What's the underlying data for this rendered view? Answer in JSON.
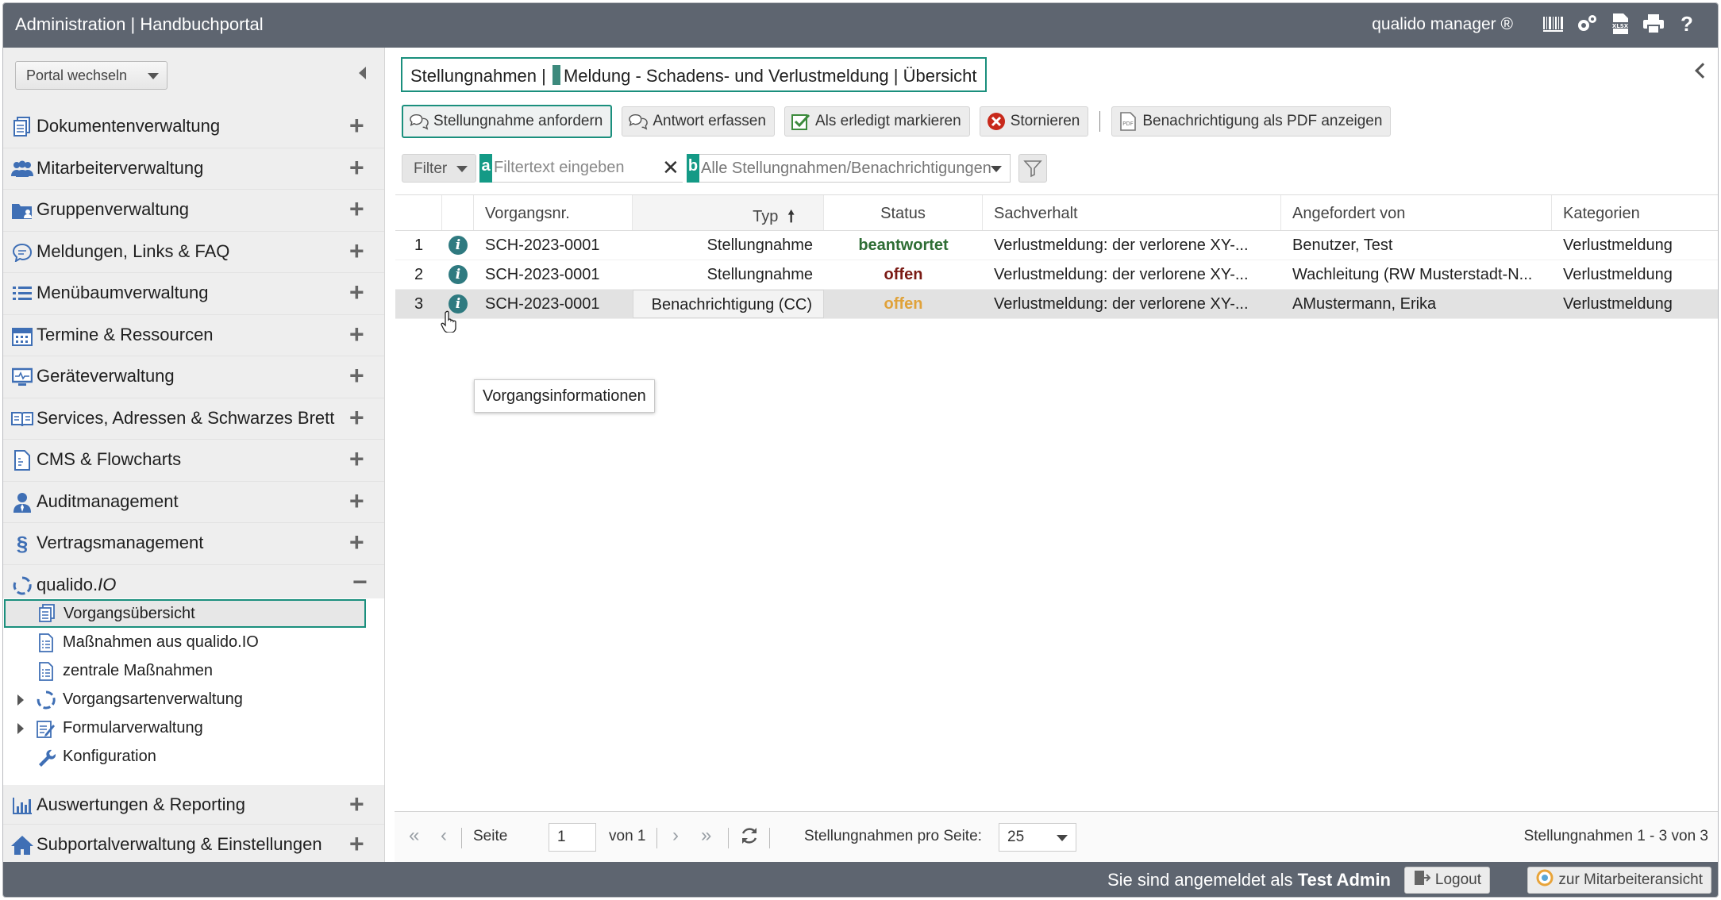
{
  "header": {
    "title": "Administration | Handbuchportal",
    "brand": "qualido manager ®",
    "icons": [
      "barcode-icon",
      "settings-icon",
      "xlsx-icon",
      "print-icon",
      "help-icon"
    ]
  },
  "sidebar": {
    "portal_select": "Portal wechseln",
    "items": [
      {
        "label": "Dokumentenverwaltung",
        "icon": "documents-icon"
      },
      {
        "label": "Mitarbeiterverwaltung",
        "icon": "users-icon"
      },
      {
        "label": "Gruppenverwaltung",
        "icon": "group-folder-icon"
      },
      {
        "label": "Meldungen, Links & FAQ",
        "icon": "chat-icon"
      },
      {
        "label": "Menübaumverwaltung",
        "icon": "list-icon"
      },
      {
        "label": "Termine & Ressourcen",
        "icon": "calendar-icon"
      },
      {
        "label": "Geräteverwaltung",
        "icon": "monitor-icon"
      },
      {
        "label": "Services, Adressen & Schwarzes Brett",
        "icon": "book-icon"
      },
      {
        "label": "CMS & Flowcharts",
        "icon": "cms-icon"
      },
      {
        "label": "Auditmanagement",
        "icon": "auditor-icon"
      },
      {
        "label": "Vertragsmanagement",
        "icon": "paragraph-icon"
      }
    ],
    "expanded": {
      "label": "qualido.",
      "label_italic": "IO",
      "icon": "qualido-icon"
    },
    "sub_items": [
      {
        "label": "Vorgangsübersicht",
        "icon": "documents-icon"
      },
      {
        "label": "Maßnahmen aus qualido.IO",
        "icon": "checklist-icon"
      },
      {
        "label": "zentrale Maßnahmen",
        "icon": "checklist-icon"
      },
      {
        "label": "Vorgangsartenverwaltung",
        "icon": "qualido-icon"
      },
      {
        "label": "Formularverwaltung",
        "icon": "form-edit-icon"
      },
      {
        "label": "Konfiguration",
        "icon": "wrench-icon"
      }
    ],
    "bottom_items": [
      {
        "label": "Auswertungen & Reporting",
        "icon": "bar-chart-icon"
      },
      {
        "label": "Subportalverwaltung & Einstellungen",
        "icon": "home-icon"
      }
    ]
  },
  "breadcrumb": {
    "part1": "Stellungnahmen |",
    "part2": "Meldung - Schadens- und Verlustmeldung | Übersicht"
  },
  "toolbar": {
    "request": "Stellungnahme anfordern",
    "answer": "Antwort erfassen",
    "done": "Als erledigt markieren",
    "cancel": "Stornieren",
    "pdf": "Benachrichtigung als PDF anzeigen"
  },
  "filter": {
    "label": "Filter",
    "badge_a": "a",
    "text_placeholder": "Filtertext eingeben",
    "badge_b": "b",
    "select_value": "Alle Stellungnahmen/Benachrichtigungen"
  },
  "table": {
    "columns": [
      "Vorgangsnr.",
      "Typ",
      "Status",
      "Sachverhalt",
      "Angefordert von",
      "Kategorien"
    ],
    "rows": [
      {
        "num": "1",
        "vorgang": "SCH-2023-0001",
        "typ": "Stellungnahme",
        "status": "beantwortet",
        "status_color": "#2e6d34",
        "sachverhalt": "Verlustmeldung: der verlorene XY-...",
        "angefordert": "Benutzer, Test",
        "kategorie": "Verlustmeldung"
      },
      {
        "num": "2",
        "vorgang": "SCH-2023-0001",
        "typ": "Stellungnahme",
        "status": "offen",
        "status_color": "#7a1a14",
        "sachverhalt": "Verlustmeldung: der verlorene XY-...",
        "angefordert": "Wachleitung (RW Musterstadt-N...",
        "kategorie": "Verlustmeldung"
      },
      {
        "num": "3",
        "vorgang": "SCH-2023-0001",
        "typ": "Benachrichtigung (CC)",
        "status": "offen",
        "status_color": "#e0a23a",
        "sachverhalt": "Verlustmeldung: der verlorene XY-...",
        "angefordert": "AMustermann, Erika",
        "kategorie": "Verlustmeldung"
      }
    ],
    "tooltip": "Vorgangsinformationen"
  },
  "pager": {
    "page_label": "Seite",
    "page_value": "1",
    "of_label": "von 1",
    "per_page_label": "Stellungnahmen pro Seite:",
    "per_page_value": "25",
    "summary": "Stellungnahmen 1 - 3 von 3"
  },
  "footer": {
    "login_prefix": "Sie sind angemeldet als",
    "user": "Test Admin",
    "logout": "Logout",
    "employee_view": "zur Mitarbeiteransicht"
  },
  "colors": {
    "accent": "#1a8f7d",
    "header_bg": "#5e6570",
    "icon_blue": "#3f6fb5"
  }
}
